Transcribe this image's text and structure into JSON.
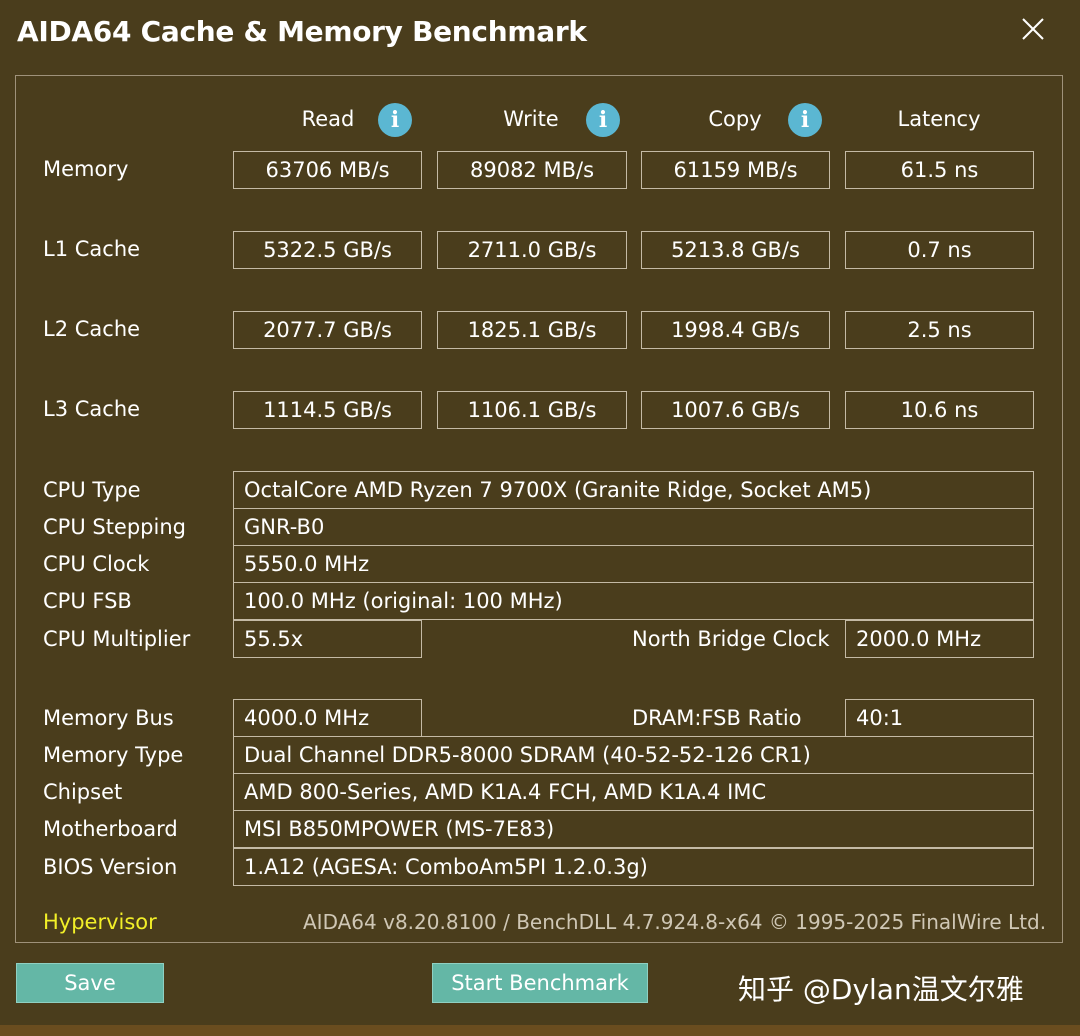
{
  "window": {
    "title": "AIDA64 Cache & Memory Benchmark",
    "close_icon": "close-icon"
  },
  "columns": {
    "read": "Read",
    "write": "Write",
    "copy": "Copy",
    "latency": "Latency",
    "info_icon": "info-icon",
    "info_glyph": "i"
  },
  "rows": [
    {
      "label": "Memory",
      "read": "63706 MB/s",
      "write": "89082 MB/s",
      "copy": "61159 MB/s",
      "latency": "61.5 ns"
    },
    {
      "label": "L1 Cache",
      "read": "5322.5 GB/s",
      "write": "2711.0 GB/s",
      "copy": "5213.8 GB/s",
      "latency": "0.7 ns"
    },
    {
      "label": "L2 Cache",
      "read": "2077.7 GB/s",
      "write": "1825.1 GB/s",
      "copy": "1998.4 GB/s",
      "latency": "2.5 ns"
    },
    {
      "label": "L3 Cache",
      "read": "1114.5 GB/s",
      "write": "1106.1 GB/s",
      "copy": "1007.6 GB/s",
      "latency": "10.6 ns"
    }
  ],
  "cpu": {
    "type_label": "CPU Type",
    "type": "OctalCore AMD Ryzen 7 9700X  (Granite Ridge, Socket AM5)",
    "stepping_label": "CPU Stepping",
    "stepping": "GNR-B0",
    "clock_label": "CPU Clock",
    "clock": "5550.0 MHz",
    "fsb_label": "CPU FSB",
    "fsb": "100.0 MHz  (original: 100 MHz)",
    "multiplier_label": "CPU Multiplier",
    "multiplier": "55.5x",
    "nb_clock_label": "North Bridge Clock",
    "nb_clock": "2000.0 MHz"
  },
  "memory": {
    "bus_label": "Memory Bus",
    "bus": "4000.0 MHz",
    "ratio_label": "DRAM:FSB Ratio",
    "ratio": "40:1",
    "type_label": "Memory Type",
    "type": "Dual Channel DDR5-8000 SDRAM  (40-52-52-126 CR1)",
    "chipset_label": "Chipset",
    "chipset": "AMD 800-Series, AMD K1A.4 FCH, AMD K1A.4 IMC",
    "motherboard_label": "Motherboard",
    "motherboard": "MSI B850MPOWER (MS-7E83)",
    "bios_label": "BIOS Version",
    "bios": "1.A12  (AGESA: ComboAm5PI 1.2.0.3g)"
  },
  "status": {
    "hypervisor": "Hypervisor",
    "footer": "AIDA64 v8.20.8100 / BenchDLL 4.7.924.8-x64 © 1995-2025 FinalWire Ltd."
  },
  "buttons": {
    "save": "Save",
    "start_benchmark": "Start Benchmark"
  },
  "watermark": "知乎 @Dylan温文尔雅",
  "colors": {
    "background": "#4a3d1c",
    "button": "#64b7a6",
    "info": "#5bb7d2",
    "hypervisor": "#f2ef28"
  }
}
